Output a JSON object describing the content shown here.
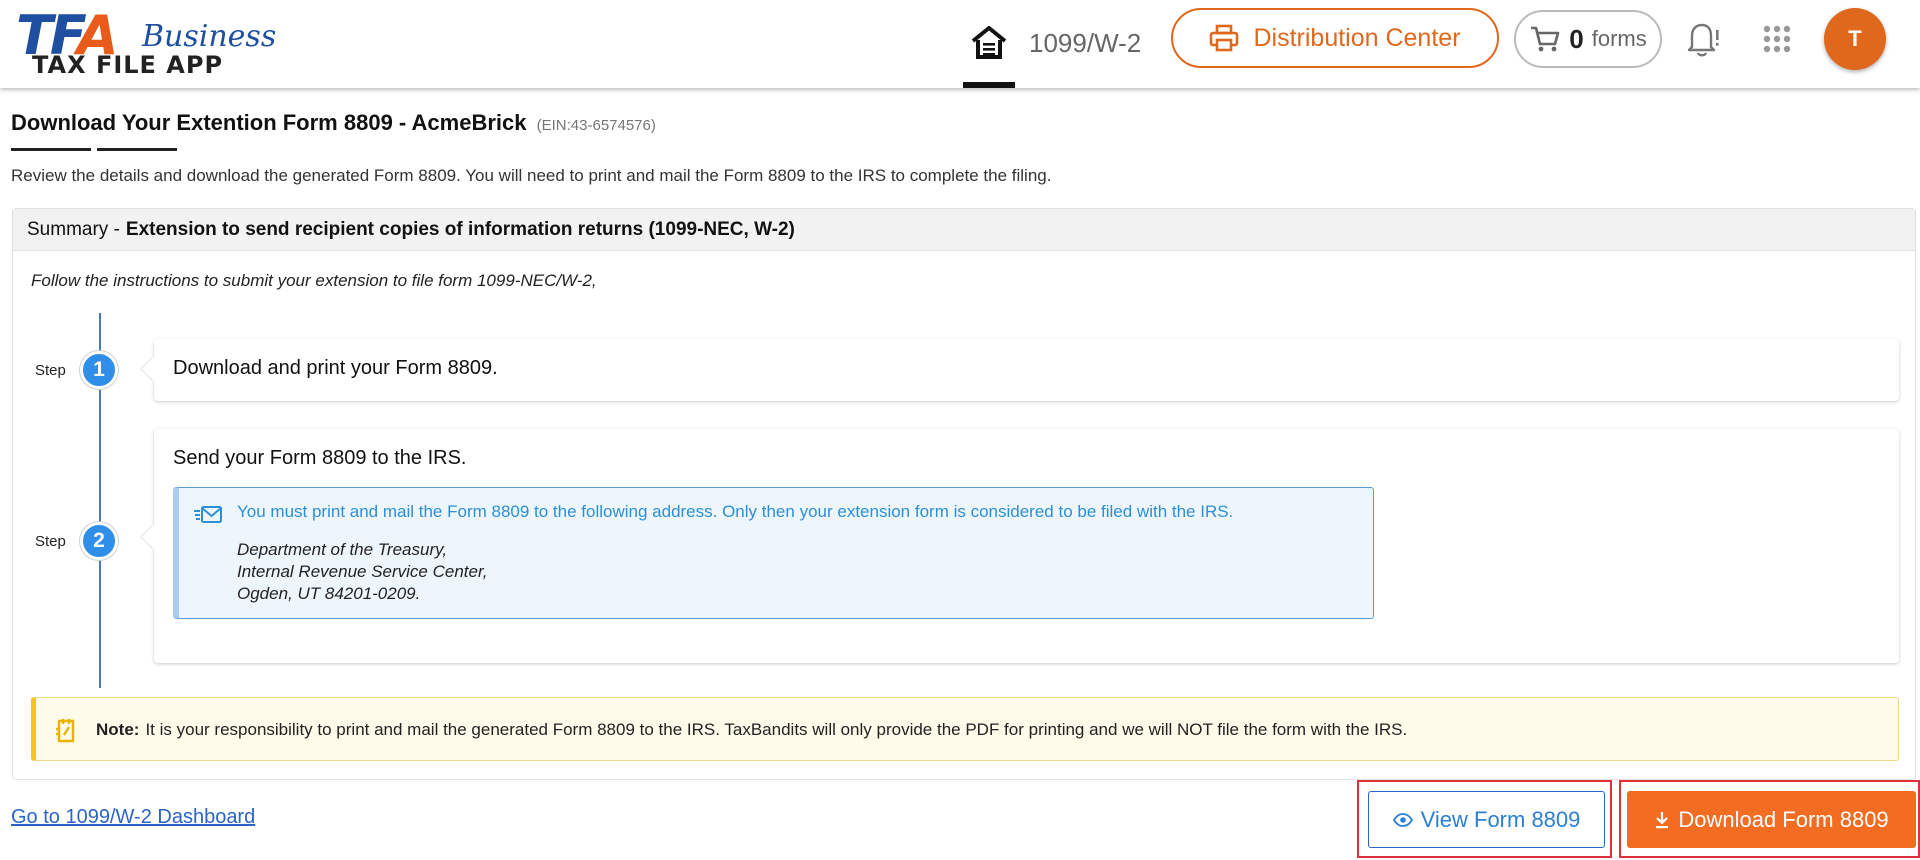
{
  "header": {
    "logo": {
      "mark_t": "TF",
      "mark_a": "A",
      "business": "Business",
      "app_name": "TAX FILE APP"
    },
    "nav": {
      "home_icon": "home-icon",
      "label_1099": "1099/W-2"
    },
    "distribution_center": {
      "label": "Distribution Center",
      "icon": "printer-icon"
    },
    "cart": {
      "count": "0",
      "label": "forms",
      "icon": "cart-icon"
    },
    "notifications_icon": "bell-icon",
    "apps_icon": "grid-icon",
    "avatar_initial": "T"
  },
  "page": {
    "title": "Download Your Extention Form 8809 - AcmeBrick",
    "ein": "(EIN:43-6574576)",
    "description": "Review the details and download the generated Form 8809. You will need to print and mail the Form 8809 to the IRS to complete the filing."
  },
  "summary": {
    "prefix": "Summary -",
    "title": "Extension to send recipient copies of information returns (1099-NEC, W-2)",
    "instructions": "Follow the instructions to submit your extension to file form 1099-NEC/W-2,",
    "steps": [
      {
        "label": "Step",
        "number": "1",
        "text": "Download and print your Form 8809."
      },
      {
        "label": "Step",
        "number": "2",
        "text": "Send your Form 8809 to the IRS."
      }
    ],
    "mail_notice": {
      "message": "You must print and mail the Form 8809 to the following address. Only then your extension form is considered to be filed with the IRS.",
      "address_lines": [
        "Department of the Treasury,",
        "Internal Revenue Service Center,",
        "Ogden, UT 84201-0209."
      ]
    },
    "note": {
      "label": "Note:",
      "text": "It is your responsibility to print and mail the generated Form 8809 to the IRS. TaxBandits will only provide the PDF for printing and we will NOT file the form with the IRS."
    }
  },
  "footer": {
    "dashboard_link": "Go to 1099/W-2 Dashboard",
    "view_button": "View Form 8809",
    "download_button": "Download Form 8809"
  },
  "colors": {
    "brand_orange": "#e0681c",
    "download_orange": "#f26c22",
    "step_blue": "#2f8ee8",
    "link_blue": "#2b63c9",
    "highlight_red": "#e0303a"
  }
}
